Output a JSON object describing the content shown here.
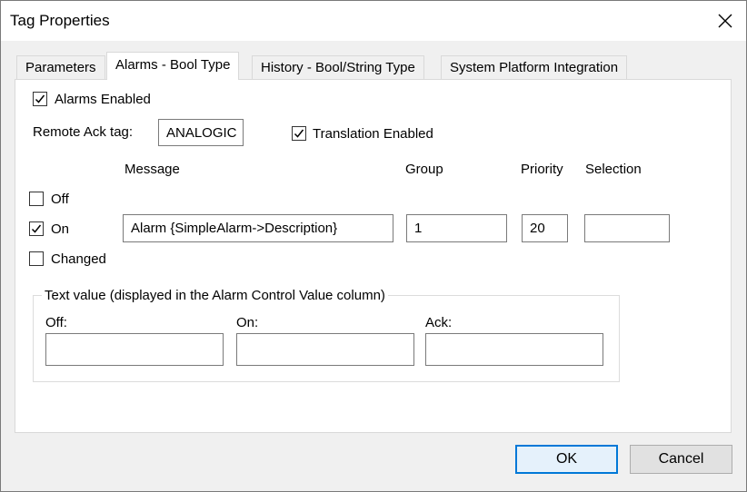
{
  "dialog": {
    "title": "Tag Properties"
  },
  "tabs": [
    {
      "label": "Parameters",
      "active": false
    },
    {
      "label": "Alarms - Bool Type",
      "active": true
    },
    {
      "label": "History - Bool/String Type",
      "active": false
    },
    {
      "label": "System Platform Integration",
      "active": false
    }
  ],
  "alarms": {
    "alarms_enabled_label": "Alarms Enabled",
    "alarms_enabled": true,
    "remote_ack_label": "Remote Ack tag:",
    "remote_ack_value": "ANALOGIC",
    "translation_enabled_label": "Translation Enabled",
    "translation_enabled": true,
    "columns": {
      "message": "Message",
      "group": "Group",
      "priority": "Priority",
      "selection": "Selection"
    },
    "rows": [
      {
        "label": "Off",
        "checked": false
      },
      {
        "label": "On",
        "checked": true,
        "message": "Alarm {SimpleAlarm->Description}",
        "group": "1",
        "priority": "20",
        "selection": ""
      },
      {
        "label": "Changed",
        "checked": false
      }
    ],
    "text_value": {
      "legend": "Text value (displayed in the Alarm Control Value column)",
      "off_label": "Off:",
      "off_value": "",
      "on_label": "On:",
      "on_value": "",
      "ack_label": "Ack:",
      "ack_value": ""
    }
  },
  "buttons": {
    "ok": "OK",
    "cancel": "Cancel"
  },
  "icons": {
    "close": "close-icon",
    "check": "checkmark-icon"
  },
  "colors": {
    "accent": "#0078d7"
  }
}
